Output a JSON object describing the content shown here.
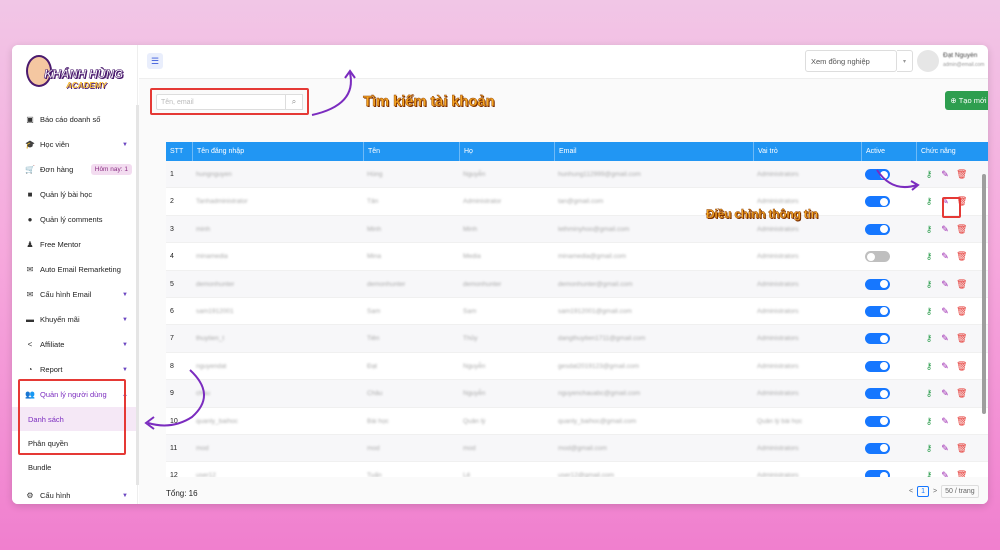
{
  "logo": {
    "title": "KHÁNH HÙNG",
    "subtitle": "ACADEMY"
  },
  "sidebar": {
    "items": [
      {
        "label": "Báo cáo doanh số",
        "icon": "dashboard-icon",
        "chevron": false
      },
      {
        "label": "Học viên",
        "icon": "graduation-cap-icon",
        "chevron": true
      },
      {
        "label": "Đơn hàng",
        "icon": "cart-icon",
        "chevron": false,
        "badge": "Hôm nay: 1"
      },
      {
        "label": "Quản lý bài học",
        "icon": "video-icon",
        "chevron": false
      },
      {
        "label": "Quản lý comments",
        "icon": "comments-icon",
        "chevron": false
      },
      {
        "label": "Free Mentor",
        "icon": "user-tie-icon",
        "chevron": false
      },
      {
        "label": "Auto Email Remarketing",
        "icon": "mail-box-icon",
        "chevron": false
      },
      {
        "label": "Cấu hình Email",
        "icon": "envelope-icon",
        "chevron": true
      },
      {
        "label": "Khuyến mãi",
        "icon": "ticket-icon",
        "chevron": true
      },
      {
        "label": "Affiliate",
        "icon": "share-icon",
        "chevron": true
      },
      {
        "label": "Report",
        "icon": "pie-chart-icon",
        "chevron": true
      },
      {
        "label": "Quản lý người dùng",
        "icon": "users-icon",
        "chevron": true,
        "expanded": true
      }
    ],
    "sub_items": [
      "Danh sách",
      "Phân quyền"
    ],
    "after_items": [
      "Bundle"
    ],
    "bottom_item": {
      "label": "Cấu hình",
      "icon": "gear-icon"
    }
  },
  "topbar": {
    "colleague_placeholder": "Xem đồng nghiệp",
    "user_name": "Đạt Nguyễn",
    "user_email": "admin@email.com"
  },
  "search": {
    "placeholder": "Tên, email"
  },
  "annotations": {
    "search": "Tìm kiếm tài khoản",
    "edit": "Điều chỉnh thông tin"
  },
  "create_button": "Tạo mới",
  "table": {
    "columns": [
      "STT",
      "Tên đăng nhập",
      "Tên",
      "Họ",
      "Email",
      "Vai trò",
      "Active",
      "Chức năng"
    ],
    "rows": [
      {
        "stt": "1",
        "username": "hungnguyen",
        "first": "Hùng",
        "last": "Nguyễn",
        "email": "hunhung112999@gmail.com",
        "role": "Administrators",
        "active": true
      },
      {
        "stt": "2",
        "username": "Tanhadministrator",
        "first": "Tân",
        "last": "Administrator",
        "email": "tan@gmail.com",
        "role": "Administrators",
        "active": true
      },
      {
        "stt": "3",
        "username": "minh",
        "first": "Minh",
        "last": "Minh",
        "email": "lethminyhoo@gmail.com",
        "role": "Administrators",
        "active": true
      },
      {
        "stt": "4",
        "username": "minamedia",
        "first": "Mina",
        "last": "Media",
        "email": "minamedia@gmail.com",
        "role": "Administrators",
        "active": false
      },
      {
        "stt": "5",
        "username": "demonhunter",
        "first": "demonhunter",
        "last": "demonhunter",
        "email": "demonhunter@gmail.com",
        "role": "Administrators",
        "active": true
      },
      {
        "stt": "6",
        "username": "sam1912001",
        "first": "Sam",
        "last": "Sam",
        "email": "sam1912001@gmail.com",
        "role": "Administrators",
        "active": true
      },
      {
        "stt": "7",
        "username": "thuytien_t",
        "first": "Tiên",
        "last": "Thủy",
        "email": "dangthuytien1711@gmail.com",
        "role": "Administrators",
        "active": true
      },
      {
        "stt": "8",
        "username": "nguyendat",
        "first": "Đạt",
        "last": "Nguyễn",
        "email": "gesdat2019123@gmail.com",
        "role": "Administrators",
        "active": true
      },
      {
        "stt": "9",
        "username": "chau",
        "first": "Châu",
        "last": "Nguyễn",
        "email": "nguyenchauabc@gmail.com",
        "role": "Administrators",
        "active": true
      },
      {
        "stt": "10",
        "username": "quanly_baihoc",
        "first": "Bài học",
        "last": "Quản lý",
        "email": "quanly_baihoc@gmail.com",
        "role": "Quản lý bài học",
        "active": true
      },
      {
        "stt": "11",
        "username": "mod",
        "first": "mod",
        "last": "mod",
        "email": "mod@gmail.com",
        "role": "Administrators",
        "active": true
      },
      {
        "stt": "12",
        "username": "user12",
        "first": "Tuấn",
        "last": "Lê",
        "email": "user12@gmail.com",
        "role": "Administrators",
        "active": true
      }
    ]
  },
  "footer": {
    "total": "Tổng: 16",
    "page_prev": "<",
    "current_page": "1",
    "page_next": ">",
    "page_size": "50 / trang"
  },
  "colors": {
    "header_blue": "#2196f3",
    "accent_purple": "#7b2cbf",
    "highlight_red": "#e53935",
    "create_green": "#2e9e4f"
  }
}
